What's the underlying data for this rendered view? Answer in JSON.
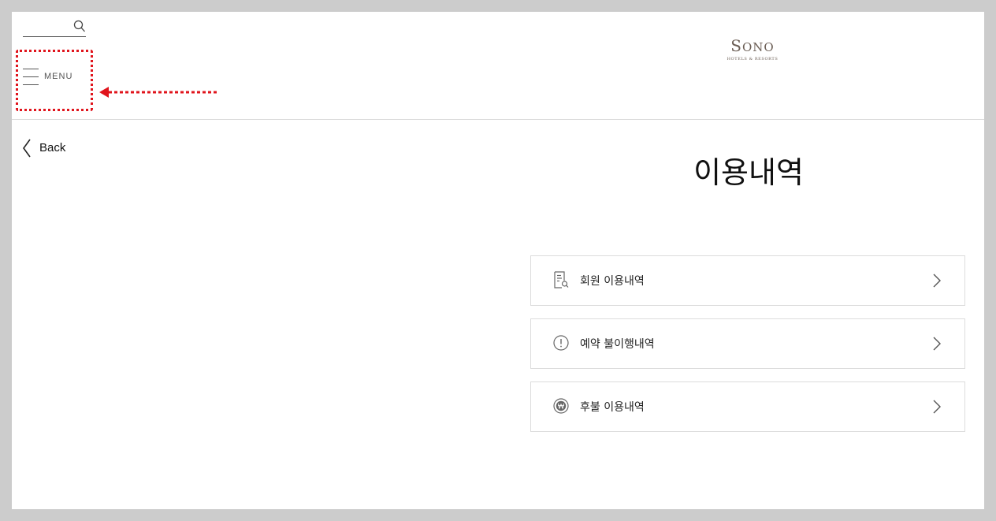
{
  "header": {
    "search": {
      "placeholder": ""
    },
    "menu_label": "MENU",
    "logo": {
      "main_s": "S",
      "main_rest": "ONO",
      "sub": "HOTELS & RESORTS"
    }
  },
  "nav": {
    "back_label": "Back"
  },
  "main": {
    "title": "이용내역",
    "items": [
      {
        "label": "회원 이용내역",
        "icon": "document-search-icon"
      },
      {
        "label": "예약 불이행내역",
        "icon": "alert-circle-icon"
      },
      {
        "label": "후불 이용내역",
        "icon": "won-coin-icon"
      }
    ]
  },
  "colors": {
    "annotation": "#e0141c",
    "logo": "#6b5e55",
    "border": "#dcdcdc",
    "background_outer": "#cccccc"
  }
}
